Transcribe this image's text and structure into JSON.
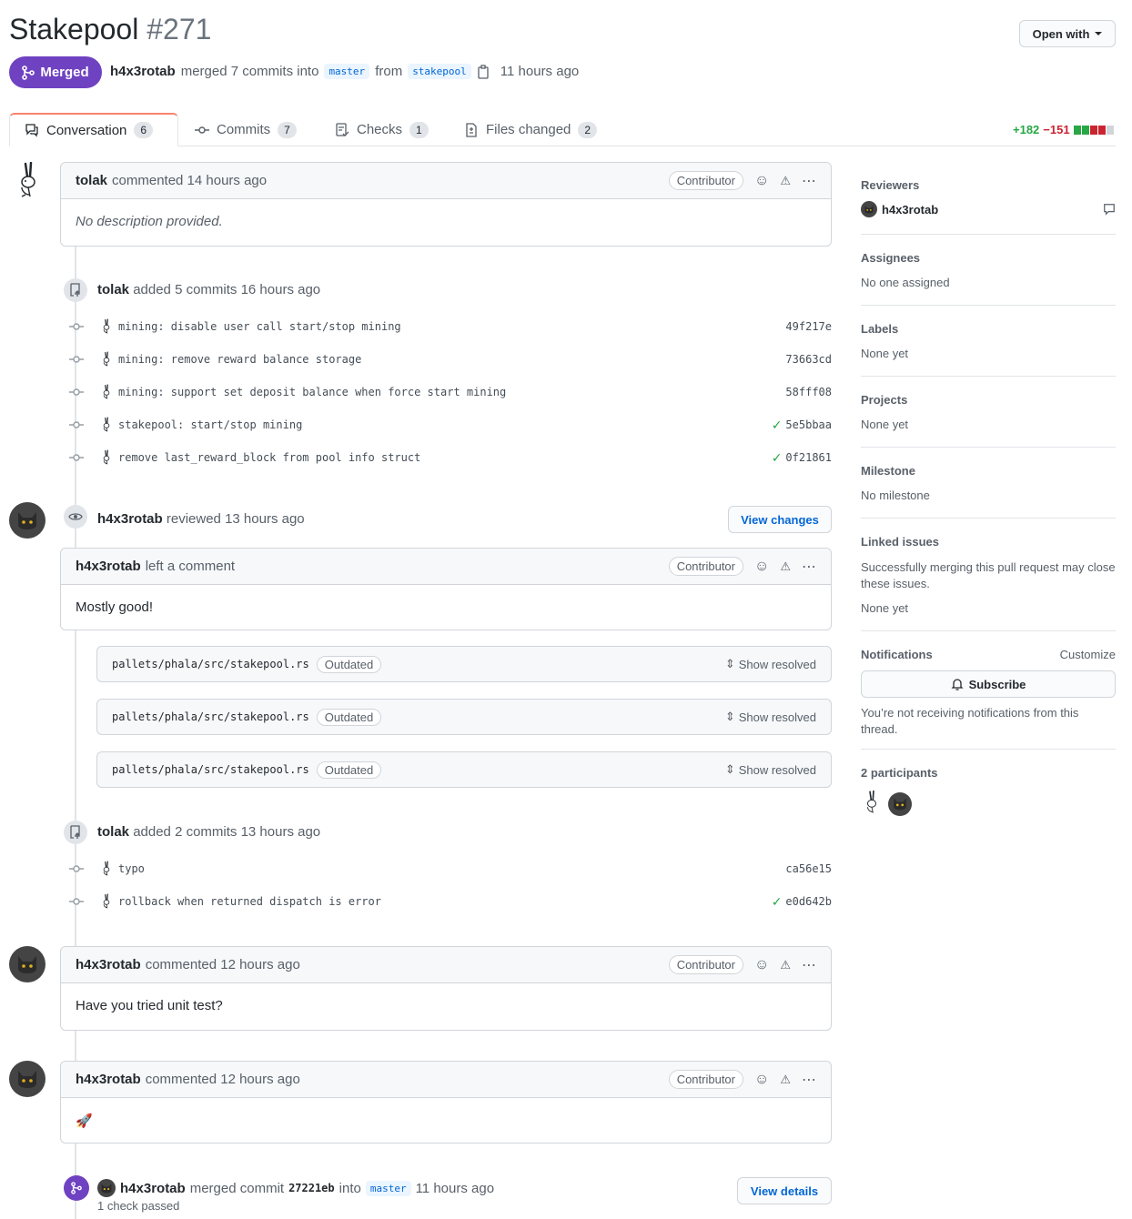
{
  "header": {
    "title": "Stakepool",
    "number": "#271",
    "open_with": "Open with",
    "state": "Merged",
    "author": "h4x3rotab",
    "action": "merged 7 commits into",
    "base_branch": "master",
    "from_text": "from",
    "head_branch": "stakepool",
    "time": "11 hours ago"
  },
  "tabs": [
    {
      "label": "Conversation",
      "count": "6",
      "icon": "comment-discussion-icon"
    },
    {
      "label": "Commits",
      "count": "7",
      "icon": "git-commit-icon"
    },
    {
      "label": "Checks",
      "count": "1",
      "icon": "checklist-icon"
    },
    {
      "label": "Files changed",
      "count": "2",
      "icon": "file-diff-icon"
    }
  ],
  "diffstat": {
    "additions": "+182",
    "deletions": "−151"
  },
  "timeline": {
    "opening_comment": {
      "author": "tolak",
      "meta": "commented 14 hours ago",
      "badge": "Contributor",
      "body": "No description provided."
    },
    "commit_group_1": {
      "author": "tolak",
      "text": "added 5 commits 16 hours ago",
      "commits": [
        {
          "message": "mining: disable user call start/stop mining",
          "sha": "49f217e",
          "check": ""
        },
        {
          "message": "mining: remove reward balance storage",
          "sha": "73663cd",
          "check": ""
        },
        {
          "message": "mining: support set deposit balance when force start mining",
          "sha": "58fff08",
          "check": ""
        },
        {
          "message": "stakepool: start/stop mining",
          "sha": "5e5bbaa",
          "check": "✓"
        },
        {
          "message": "remove last_reward_block from pool info struct",
          "sha": "0f21861",
          "check": "✓"
        }
      ]
    },
    "review": {
      "author": "h4x3rotab",
      "text": "reviewed 13 hours ago",
      "view_changes": "View changes",
      "comment_author": "h4x3rotab",
      "comment_meta": "left a comment",
      "badge": "Contributor",
      "body": "Mostly good!",
      "files": [
        {
          "path": "pallets/phala/src/stakepool.rs",
          "tag": "Outdated",
          "action": "Show resolved"
        },
        {
          "path": "pallets/phala/src/stakepool.rs",
          "tag": "Outdated",
          "action": "Show resolved"
        },
        {
          "path": "pallets/phala/src/stakepool.rs",
          "tag": "Outdated",
          "action": "Show resolved"
        }
      ]
    },
    "commit_group_2": {
      "author": "tolak",
      "text": "added 2 commits 13 hours ago",
      "commits": [
        {
          "message": "typo",
          "sha": "ca56e15",
          "check": ""
        },
        {
          "message": "rollback when returned dispatch is error",
          "sha": "e0d642b",
          "check": "✓"
        }
      ]
    },
    "comment_2": {
      "author": "h4x3rotab",
      "meta": "commented 12 hours ago",
      "badge": "Contributor",
      "body": "Have you tried unit test?"
    },
    "comment_3": {
      "author": "h4x3rotab",
      "meta": "commented 12 hours ago",
      "badge": "Contributor",
      "body": "🚀"
    },
    "merge_event": {
      "author": "h4x3rotab",
      "text_a": "merged commit",
      "sha": "27221eb",
      "text_b": "into",
      "branch": "master",
      "time": "11 hours ago",
      "checks": "1 check passed",
      "button": "View details"
    }
  },
  "sidebar": {
    "reviewers": {
      "heading": "Reviewers",
      "name": "h4x3rotab"
    },
    "assignees": {
      "heading": "Assignees",
      "value": "No one assigned"
    },
    "labels": {
      "heading": "Labels",
      "value": "None yet"
    },
    "projects": {
      "heading": "Projects",
      "value": "None yet"
    },
    "milestone": {
      "heading": "Milestone",
      "value": "No milestone"
    },
    "linked_issues": {
      "heading": "Linked issues",
      "desc": "Successfully merging this pull request may close these issues.",
      "value": "None yet"
    },
    "notifications": {
      "heading": "Notifications",
      "customize": "Customize",
      "subscribe": "Subscribe",
      "desc": "You’re not receiving notifications from this thread."
    },
    "participants": {
      "heading": "2 participants"
    }
  },
  "colors": {
    "merged": "#6f42c1",
    "link": "#0366d6",
    "success": "#28a745",
    "danger": "#cb2431"
  }
}
